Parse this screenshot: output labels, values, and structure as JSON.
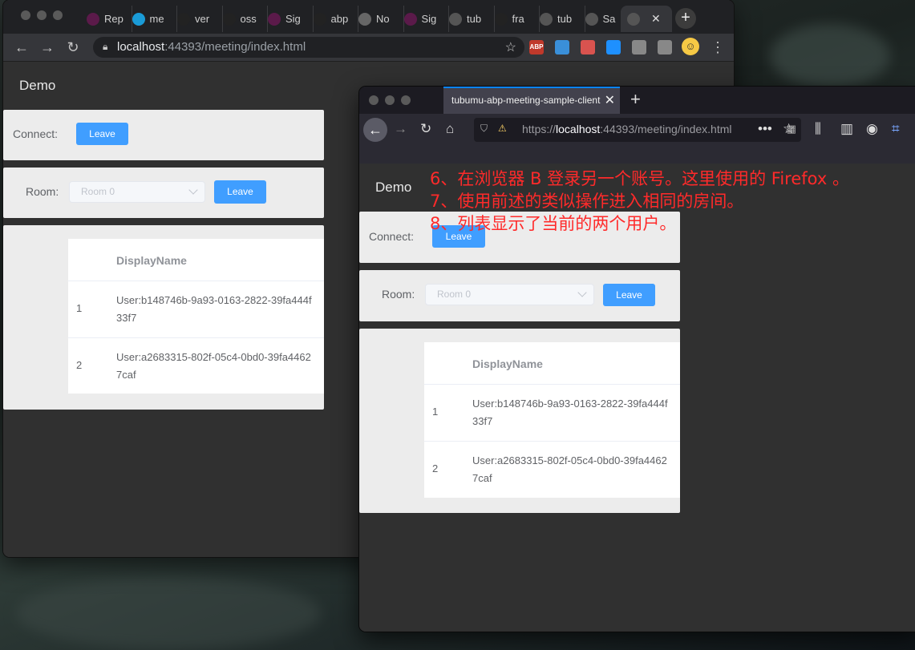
{
  "chrome": {
    "tabs": [
      {
        "label": "Rep",
        "icon": "signalr-icon",
        "color": "#5b1a4a"
      },
      {
        "label": "me",
        "icon": "circle-icon",
        "color": "#1a9bd7"
      },
      {
        "label": "ver",
        "icon": "github-icon",
        "color": "#222"
      },
      {
        "label": "oss",
        "icon": "github-icon",
        "color": "#222"
      },
      {
        "label": "Sig",
        "icon": "signalr-icon",
        "color": "#5b1a4a"
      },
      {
        "label": "abp",
        "icon": "github-icon",
        "color": "#222"
      },
      {
        "label": "No",
        "icon": "cat-icon",
        "color": "#666"
      },
      {
        "label": "Sig",
        "icon": "signalr-icon",
        "color": "#5b1a4a"
      },
      {
        "label": "tub",
        "icon": "globe-icon",
        "color": "#555"
      },
      {
        "label": "fra",
        "icon": "github-icon",
        "color": "#222"
      },
      {
        "label": "tub",
        "icon": "globe-icon",
        "color": "#555"
      },
      {
        "label": "Sa",
        "icon": "globe-icon",
        "color": "#555"
      }
    ],
    "url_host": "localhost",
    "url_rest": ":44393/meeting/index.html",
    "extensions": [
      {
        "name": "abp-icon",
        "text": "ABP",
        "color": "#c0392b"
      },
      {
        "name": "shield-ext-icon",
        "text": "",
        "color": "#3a8fd9"
      },
      {
        "name": "network-ext-icon",
        "text": "",
        "color": "#d9534f"
      },
      {
        "name": "bookmark-ext-icon",
        "text": "",
        "color": "#1e90ff"
      },
      {
        "name": "square-ext-icon",
        "text": "",
        "color": "#888"
      },
      {
        "name": "puzzle-icon",
        "text": "",
        "color": "#888"
      }
    ]
  },
  "firefox": {
    "tab_title": "tubumu-abp-meeting-sample-client",
    "url_prefix": "https://",
    "url_host": "localhost",
    "url_rest": ":44393/meeting/index.html"
  },
  "app": {
    "title": "Demo",
    "connect_label": "Connect:",
    "connect_button": "Leave",
    "room_label": "Room:",
    "room_select_value": "Room 0",
    "room_button": "Leave",
    "table": {
      "header": "DisplayName",
      "rows": [
        {
          "index": "1",
          "display_name": "User:b148746b-9a93-0163-2822-39fa444f33f7"
        },
        {
          "index": "2",
          "display_name": "User:a2683315-802f-05c4-0bd0-39fa44627caf"
        }
      ]
    }
  },
  "annotation": [
    "6、在浏览器 B 登录另一个账号。这里使用的 Firefox 。",
    "7、使用前述的类似操作进入相同的房间。",
    "8、列表显示了当前的两个用户。"
  ]
}
